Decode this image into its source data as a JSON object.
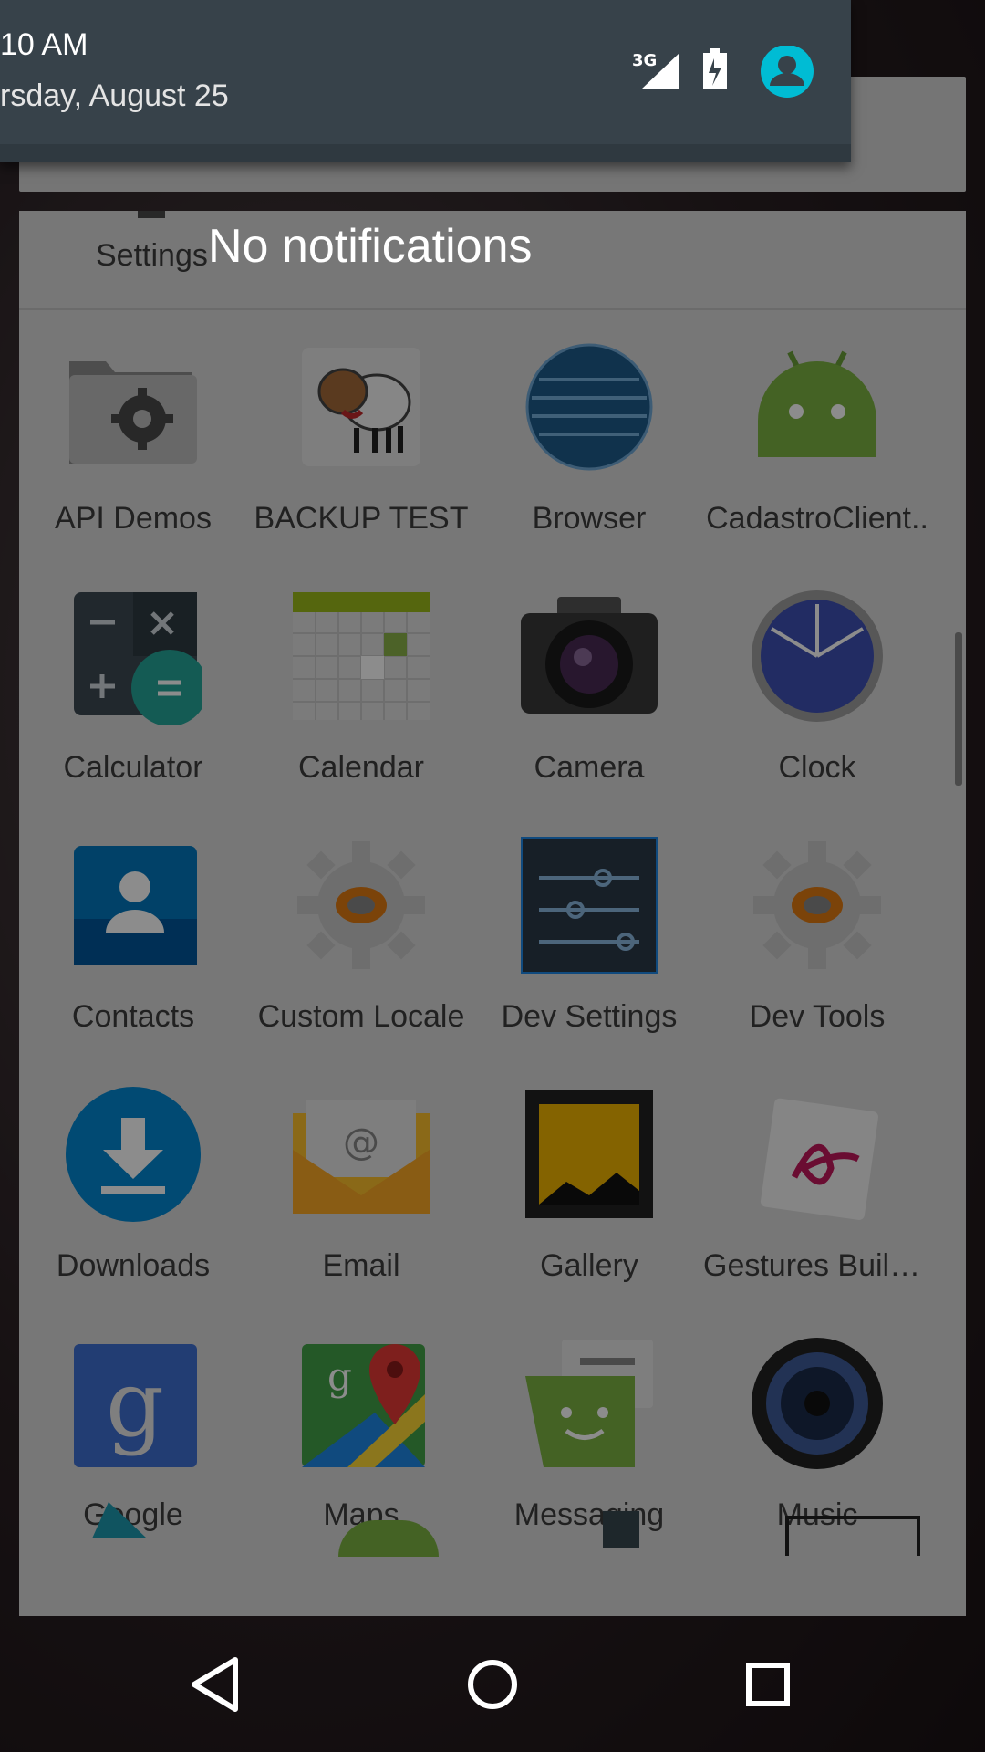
{
  "shade": {
    "time": "10 AM",
    "date": "rsday, August 25",
    "network_badge": "3G",
    "empty_message": "No notifications"
  },
  "drawer": {
    "header_label": "Settings",
    "apps": [
      {
        "label": "API Demos",
        "icon": "folder-gear-icon"
      },
      {
        "label": "BACKUP TEST",
        "icon": "sheep-icon"
      },
      {
        "label": "Browser",
        "icon": "globe-icon"
      },
      {
        "label": "CadastroClient..",
        "icon": "android-icon"
      },
      {
        "label": "Calculator",
        "icon": "calculator-icon"
      },
      {
        "label": "Calendar",
        "icon": "calendar-icon"
      },
      {
        "label": "Camera",
        "icon": "camera-icon"
      },
      {
        "label": "Clock",
        "icon": "clock-icon"
      },
      {
        "label": "Contacts",
        "icon": "contacts-icon"
      },
      {
        "label": "Custom Locale",
        "icon": "gear-icon"
      },
      {
        "label": "Dev Settings",
        "icon": "sliders-icon"
      },
      {
        "label": "Dev Tools",
        "icon": "gear-icon"
      },
      {
        "label": "Downloads",
        "icon": "download-icon"
      },
      {
        "label": "Email",
        "icon": "email-icon"
      },
      {
        "label": "Gallery",
        "icon": "gallery-icon"
      },
      {
        "label": "Gestures Builder",
        "icon": "gestures-icon"
      },
      {
        "label": "Google",
        "icon": "google-icon"
      },
      {
        "label": "Maps",
        "icon": "maps-icon"
      },
      {
        "label": "Messaging",
        "icon": "messaging-icon"
      },
      {
        "label": "Music",
        "icon": "speaker-icon"
      }
    ]
  },
  "colors": {
    "shade_bg": "#37424a",
    "avatar": "#00bcd4",
    "drawer_bg": "#d9d9d9"
  }
}
